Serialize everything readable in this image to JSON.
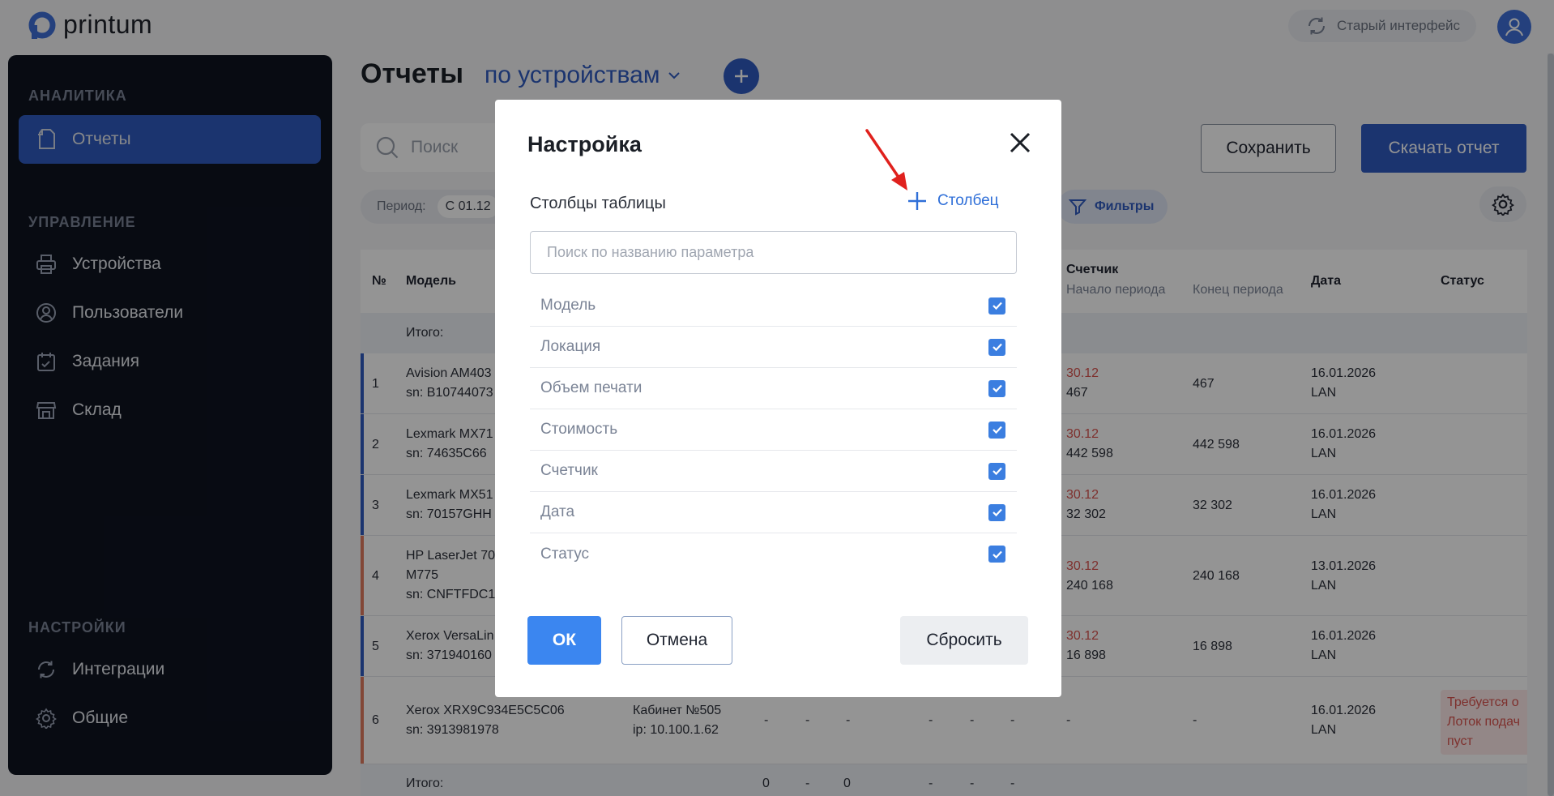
{
  "app": {
    "logo_text": "printum"
  },
  "topbar": {
    "old_ui_label": "Старый интерфейс"
  },
  "sidebar": {
    "sections": [
      {
        "label": "АНАЛИТИКА"
      },
      {
        "label": "УПРАВЛЕНИЕ"
      },
      {
        "label": "НАСТРОЙКИ"
      }
    ],
    "items": [
      {
        "label": "Отчеты",
        "icon": "document-icon",
        "active": true
      },
      {
        "label": "Устройства",
        "icon": "printer-icon"
      },
      {
        "label": "Пользователи",
        "icon": "user-circle-icon"
      },
      {
        "label": "Задания",
        "icon": "clipboard-check-icon"
      },
      {
        "label": "Склад",
        "icon": "store-icon"
      },
      {
        "label": "Интеграции",
        "icon": "sync-icon"
      },
      {
        "label": "Общие",
        "icon": "gear-icon"
      }
    ]
  },
  "main": {
    "title": "Отчеты",
    "report_type": "по устройствам",
    "search_placeholder": "Поиск",
    "save_label": "Сохранить",
    "download_label": "Скачать отчет",
    "period_label": "Период:",
    "period_value": "С 01.12",
    "filters_label": "Фильтры"
  },
  "table": {
    "headers": {
      "num": "№",
      "model": "Модель",
      "counter": "Счетчик",
      "counter_start": "Начало периода",
      "counter_end": "Конец периода",
      "date": "Дата",
      "status": "Статус"
    },
    "total_label": "Итого:",
    "rows": [
      {
        "num": "1",
        "model": "Avision AM403",
        "sn": "sn: B10744073",
        "start_date": "30.12",
        "start": "467",
        "end": "467",
        "date": "16.01.2026",
        "conn": "LAN"
      },
      {
        "num": "2",
        "model": "Lexmark MX71",
        "sn": "sn: 74635C66",
        "start_date": "30.12",
        "start": "442 598",
        "end": "442 598",
        "date": "16.01.2026",
        "conn": "LAN"
      },
      {
        "num": "3",
        "model": "Lexmark MX51",
        "sn": "sn: 70157GHH",
        "start_date": "30.12",
        "start": "32 302",
        "end": "32 302",
        "date": "16.01.2026",
        "conn": "LAN"
      },
      {
        "num": "4",
        "model": "HP LaserJet 70",
        "model2": "M775",
        "sn": "sn: CNFTFDC1",
        "start_date": "30.12",
        "start": "240 168",
        "end": "240 168",
        "date": "13.01.2026",
        "conn": "LAN"
      },
      {
        "num": "5",
        "model": "Xerox VersaLin",
        "sn": "sn: 371940160",
        "start_date": "30.12",
        "start": "16 898",
        "end": "16 898",
        "date": "16.01.2026",
        "conn": "LAN"
      },
      {
        "num": "6",
        "model": "Xerox XRX9C934E5C5C06",
        "sn": "sn: 3913981978",
        "location": "Кабинет №505",
        "ip": "ip: 10.100.1.62",
        "dash": "-",
        "start": "-",
        "end": "-",
        "date": "16.01.2026",
        "conn": "LAN",
        "status_lines": [
          "Требуется о",
          "Лоток подач",
          "пуст"
        ]
      }
    ],
    "footer": {
      "label": "Итого:",
      "v1": "0",
      "v2": "-",
      "v3": "0",
      "v4": "-",
      "v5": "-",
      "v6": "-"
    }
  },
  "modal": {
    "title": "Настройка",
    "columns_label": "Столбцы таблицы",
    "add_column_label": "Столбец",
    "search_placeholder": "Поиск по названию параметра",
    "params": [
      {
        "label": "Модель",
        "checked": true
      },
      {
        "label": "Локация",
        "checked": true
      },
      {
        "label": "Объем печати",
        "checked": true
      },
      {
        "label": "Стоимость",
        "checked": true
      },
      {
        "label": "Счетчик",
        "checked": true
      },
      {
        "label": "Дата",
        "checked": true
      },
      {
        "label": "Статус",
        "checked": true
      }
    ],
    "ok_label": "ОК",
    "cancel_label": "Отмена",
    "reset_label": "Сбросить"
  },
  "colors": {
    "accent": "#2f5bbf",
    "ok_button": "#3b86f0",
    "checkbox": "#3b7ee0",
    "annotation_arrow": "#e0211d",
    "warning_text": "#d9534f"
  }
}
